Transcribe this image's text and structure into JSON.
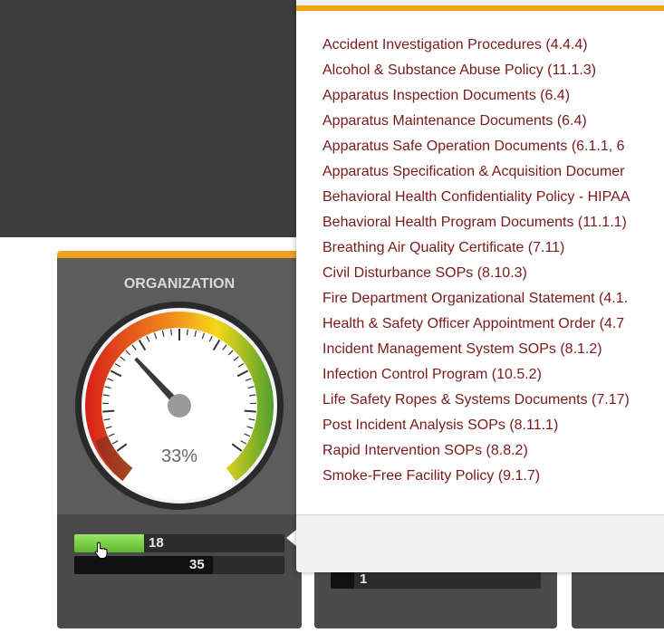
{
  "organization_card": {
    "title": "ORGANIZATION",
    "gauge": {
      "percent_label": "33%",
      "value": 0.33
    },
    "bar_completed": {
      "value": "18",
      "fill": 0.33
    },
    "bar_total": {
      "value": "35",
      "fill": 0.66
    }
  },
  "mid_card": {
    "bar_value": "1"
  },
  "document_popup": {
    "items": [
      "Accident Investigation Procedures (4.4.4)",
      "Alcohol & Substance Abuse Policy (11.1.3)",
      "Apparatus Inspection Documents (6.4)",
      "Apparatus Maintenance Documents (6.4)",
      "Apparatus Safe Operation Documents (6.1.1, 6",
      "Apparatus Specification & Acquisition Documer",
      "Behavioral Health Confidentiality Policy - HIPAA",
      "Behavioral Health Program Documents (11.1.1)",
      "Breathing Air Quality Certificate (7.11)",
      "Civil Disturbance SOPs (8.10.3)",
      "Fire Department Organizational Statement (4.1.",
      "Health & Safety Officer Appointment Order (4.7",
      "Incident Management System SOPs (8.1.2)",
      "Infection Control Program (10.5.2)",
      "Life Safety Ropes & Systems Documents (7.17)",
      "Post Incident Analysis SOPs (8.11.1)",
      "Rapid Intervention SOPs (8.8.2)",
      "Smoke-Free Facility Policy (9.1.7)"
    ]
  },
  "colors": {
    "accent": "#f2a21b",
    "link": "#7a1a1a",
    "progress_green": "#5cb82a",
    "gauge_red": "#e0201c",
    "gauge_yellow": "#f6d81a",
    "gauge_green": "#5fa834"
  }
}
